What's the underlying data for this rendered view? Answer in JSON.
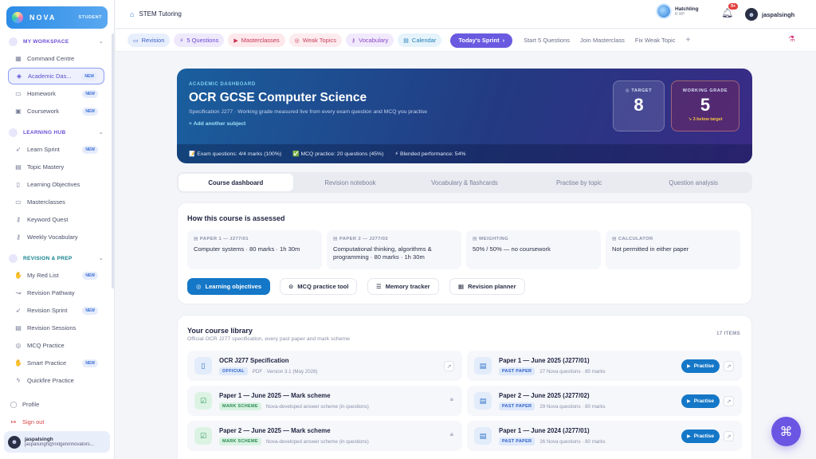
{
  "brand": {
    "name": "NOVA",
    "tag": "STUDENT"
  },
  "sidebar": {
    "sections": [
      {
        "label": "MY WORKSPACE",
        "items": [
          {
            "label": "Command Centre",
            "icon": "grid-icon",
            "badge": ""
          },
          {
            "label": "Academic Das...",
            "icon": "graduation-cap-icon",
            "badge": "NEW",
            "active": true
          },
          {
            "label": "Homework",
            "icon": "book-icon",
            "badge": "NEW"
          },
          {
            "label": "Coursework",
            "icon": "clipboard-icon",
            "badge": "NEW"
          }
        ]
      },
      {
        "label": "LEARNING HUB",
        "items": [
          {
            "label": "Learn Sprint",
            "icon": "rocket-icon",
            "badge": "NEW"
          },
          {
            "label": "Topic Mastery",
            "icon": "table-icon",
            "badge": ""
          },
          {
            "label": "Learning Objectives",
            "icon": "book-open-icon",
            "badge": ""
          },
          {
            "label": "Masterclasses",
            "icon": "monitor-icon",
            "badge": ""
          },
          {
            "label": "Keyword Quest",
            "icon": "key-icon",
            "badge": ""
          },
          {
            "label": "Weekly Vocabulary",
            "icon": "key-icon",
            "badge": ""
          }
        ]
      },
      {
        "label": "REVISION & PREP",
        "items": [
          {
            "label": "My Red List",
            "icon": "hand-icon",
            "badge": "NEW"
          },
          {
            "label": "Revision Pathway",
            "icon": "route-icon",
            "badge": ""
          },
          {
            "label": "Revision Sprint",
            "icon": "rocket-icon",
            "badge": "NEW"
          },
          {
            "label": "Revision Sessions",
            "icon": "table-icon",
            "badge": ""
          },
          {
            "label": "MCQ Practice",
            "icon": "target-icon",
            "badge": ""
          },
          {
            "label": "Smart Practice",
            "icon": "hand-icon",
            "badge": "NEW"
          },
          {
            "label": "Quickfire Practice",
            "icon": "bolt-icon",
            "badge": ""
          }
        ]
      }
    ],
    "bottom": {
      "profile": "Profile",
      "signout": "Sign out"
    },
    "user": {
      "name": "jaspalsingh",
      "email": "jaspalsingh@nxtgeninnovators..."
    }
  },
  "topbar": {
    "title": "STEM Tutoring",
    "xp_label": "Hatchling",
    "xp_value": "0 XP",
    "notif_count": "9+",
    "username": "jaspalsingh"
  },
  "chips": [
    {
      "label": "Revision",
      "style": "c-blue",
      "icon": "▭"
    },
    {
      "label": "5 Questions",
      "style": "c-purple",
      "icon": "⚡"
    },
    {
      "label": "Masterclasses",
      "style": "c-red",
      "icon": "▶"
    },
    {
      "label": "Weak Topics",
      "style": "c-rose",
      "icon": "◎"
    },
    {
      "label": "Vocabulary",
      "style": "c-violet",
      "icon": "⚷"
    },
    {
      "label": "Calendar",
      "style": "c-sky",
      "icon": "▤"
    }
  ],
  "sprint_label": "Today's Sprint",
  "quick_links": [
    "Start 5 Questions",
    "Join Masterclass",
    "Fix Weak Topic"
  ],
  "hero": {
    "eyebrow": "ACADEMIC DASHBOARD",
    "title": "OCR GCSE Computer Science",
    "subtitle": "Specification J277 · Working grade measured live from every exam question and MCQ you practise",
    "add_subject": "+ Add another subject",
    "stats": [
      "📝 Exam questions: 4/4 marks (100%)",
      "✅ MCQ practice: 20 questions (45%)",
      "⚡ Blended performance: 54%"
    ],
    "target": {
      "label": "TARGET",
      "value": "8"
    },
    "working": {
      "label": "WORKING GRADE",
      "value": "5",
      "note": "↘ 3 below target"
    }
  },
  "tabs": [
    "Course dashboard",
    "Revision notebook",
    "Vocabulary & flashcards",
    "Practise by topic",
    "Question analysis"
  ],
  "assessed": {
    "title": "How this course is assessed",
    "cards": [
      {
        "label": "PAPER 1 — J277/01",
        "value": "Computer systems · 80 marks · 1h 30m"
      },
      {
        "label": "PAPER 2 — J277/02",
        "value": "Computational thinking, algorithms & programming · 80 marks · 1h 30m"
      },
      {
        "label": "WEIGHTING",
        "value": "50% / 50% — no coursework"
      },
      {
        "label": "CALCULATOR",
        "value": "Not permitted in either paper"
      }
    ],
    "buttons": [
      "Learning objectives",
      "MCQ practice tool",
      "Memory tracker",
      "Revision planner"
    ]
  },
  "library": {
    "title": "Your course library",
    "subtitle": "Official OCR J277 specification, every past paper and mark scheme",
    "count": "17 ITEMS",
    "practise_label": "Practise",
    "left": [
      {
        "title": "OCR J277 Specification",
        "tag": "OFFICIAL",
        "meta": "PDF · Version 3.1 (May 2026)",
        "kind": "spec"
      },
      {
        "title": "Paper 1 — June 2025 — Mark scheme",
        "tag": "MARK SCHEME",
        "meta": "Nova-developed answer scheme (in questions)",
        "kind": "ms"
      },
      {
        "title": "Paper 2 — June 2025 — Mark scheme",
        "tag": "MARK SCHEME",
        "meta": "Nova-developed answer scheme (in questions)",
        "kind": "ms"
      }
    ],
    "right": [
      {
        "title": "Paper 1 — June 2025 (J277/01)",
        "tag": "PAST PAPER",
        "meta": "27 Nova questions · 80 marks"
      },
      {
        "title": "Paper 2 — June 2025 (J277/02)",
        "tag": "PAST PAPER",
        "meta": "29 Nova questions · 80 marks"
      },
      {
        "title": "Paper 1 — June 2024 (J277/01)",
        "tag": "PAST PAPER",
        "meta": "26 Nova questions · 80 marks"
      }
    ]
  }
}
